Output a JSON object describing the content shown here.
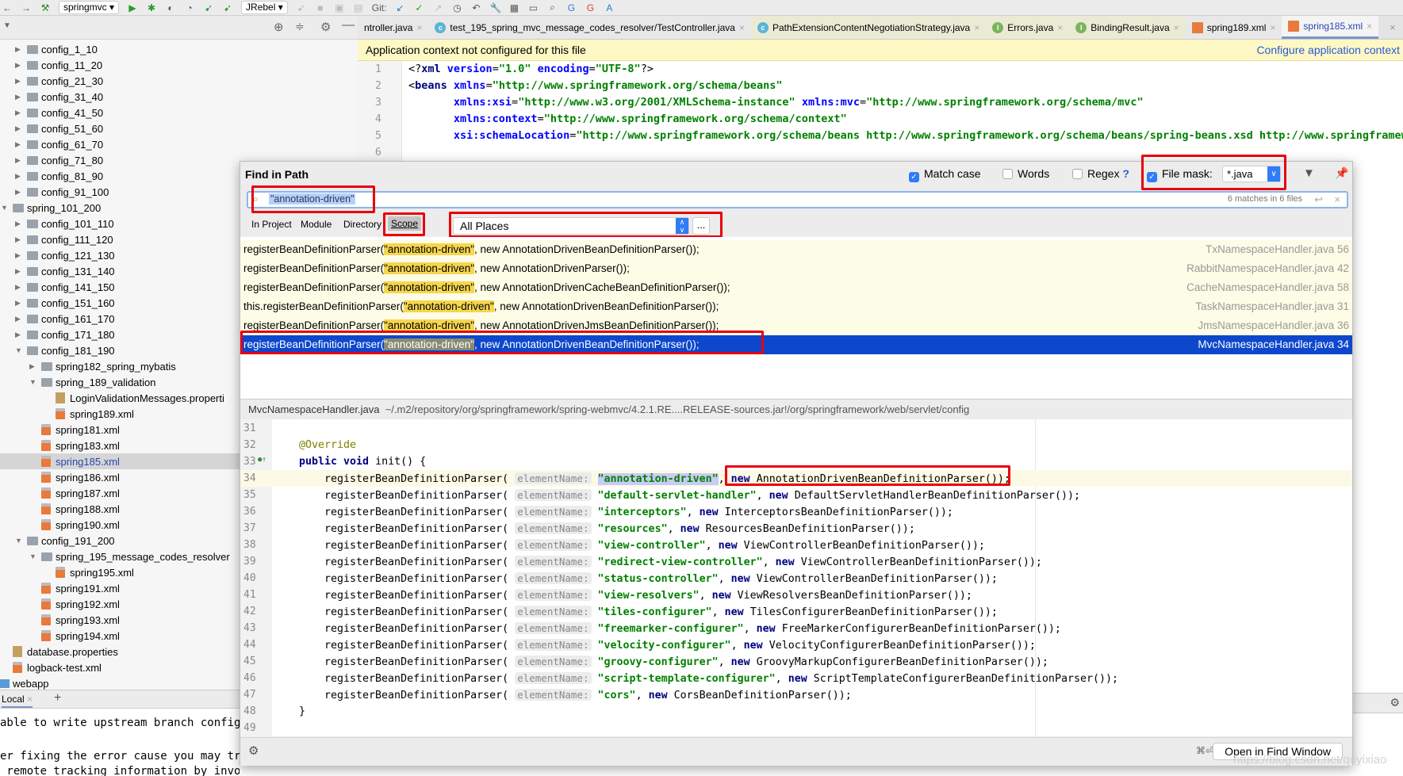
{
  "toolbar": {
    "run_config": "springmvc",
    "jrebel": "JRebel",
    "git_label": "Git:"
  },
  "tabs": [
    {
      "label": "ntroller.java",
      "kind": "plain",
      "style": "plain"
    },
    {
      "label": "test_195_spring_mvc_message_codes_resolver/TestController.java",
      "kind": "C",
      "style": "plain"
    },
    {
      "label": "PathExtensionContentNegotiationStrategy.java",
      "kind": "C",
      "style": "yel"
    },
    {
      "label": "Errors.java",
      "kind": "I",
      "style": "yel"
    },
    {
      "label": "BindingResult.java",
      "kind": "I",
      "style": "yel"
    },
    {
      "label": "spring189.xml",
      "kind": "xml",
      "style": "plain"
    },
    {
      "label": "spring185.xml",
      "kind": "xml",
      "style": "active"
    }
  ],
  "tree": [
    {
      "label": "config_1_10",
      "level": 2,
      "type": "folder",
      "arrow": "right"
    },
    {
      "label": "config_11_20",
      "level": 2,
      "type": "folder",
      "arrow": "right"
    },
    {
      "label": "config_21_30",
      "level": 2,
      "type": "folder",
      "arrow": "right"
    },
    {
      "label": "config_31_40",
      "level": 2,
      "type": "folder",
      "arrow": "right"
    },
    {
      "label": "config_41_50",
      "level": 2,
      "type": "folder",
      "arrow": "right"
    },
    {
      "label": "config_51_60",
      "level": 2,
      "type": "folder",
      "arrow": "right"
    },
    {
      "label": "config_61_70",
      "level": 2,
      "type": "folder",
      "arrow": "right"
    },
    {
      "label": "config_71_80",
      "level": 2,
      "type": "folder",
      "arrow": "right"
    },
    {
      "label": "config_81_90",
      "level": 2,
      "type": "folder",
      "arrow": "right"
    },
    {
      "label": "config_91_100",
      "level": 2,
      "type": "folder",
      "arrow": "right"
    },
    {
      "label": "spring_101_200",
      "level": 1,
      "type": "folder",
      "arrow": "down"
    },
    {
      "label": "config_101_110",
      "level": 2,
      "type": "folder",
      "arrow": "right"
    },
    {
      "label": "config_111_120",
      "level": 2,
      "type": "folder",
      "arrow": "right"
    },
    {
      "label": "config_121_130",
      "level": 2,
      "type": "folder",
      "arrow": "right"
    },
    {
      "label": "config_131_140",
      "level": 2,
      "type": "folder",
      "arrow": "right"
    },
    {
      "label": "config_141_150",
      "level": 2,
      "type": "folder",
      "arrow": "right"
    },
    {
      "label": "config_151_160",
      "level": 2,
      "type": "folder",
      "arrow": "right"
    },
    {
      "label": "config_161_170",
      "level": 2,
      "type": "folder",
      "arrow": "right"
    },
    {
      "label": "config_171_180",
      "level": 2,
      "type": "folder",
      "arrow": "right"
    },
    {
      "label": "config_181_190",
      "level": 2,
      "type": "folder",
      "arrow": "down"
    },
    {
      "label": "spring182_spring_mybatis",
      "level": 3,
      "type": "folder",
      "arrow": "right"
    },
    {
      "label": "spring_189_validation",
      "level": 3,
      "type": "folder",
      "arrow": "down"
    },
    {
      "label": "LoginValidationMessages.properti",
      "level": 4,
      "type": "props",
      "arrow": ""
    },
    {
      "label": "spring189.xml",
      "level": 4,
      "type": "xml",
      "arrow": ""
    },
    {
      "label": "spring181.xml",
      "level": 3,
      "type": "xml",
      "arrow": ""
    },
    {
      "label": "spring183.xml",
      "level": 3,
      "type": "xml",
      "arrow": ""
    },
    {
      "label": "spring185.xml",
      "level": 3,
      "type": "xml",
      "arrow": "",
      "selected": true
    },
    {
      "label": "spring186.xml",
      "level": 3,
      "type": "xml",
      "arrow": ""
    },
    {
      "label": "spring187.xml",
      "level": 3,
      "type": "xml",
      "arrow": ""
    },
    {
      "label": "spring188.xml",
      "level": 3,
      "type": "xml",
      "arrow": ""
    },
    {
      "label": "spring190.xml",
      "level": 3,
      "type": "xml",
      "arrow": ""
    },
    {
      "label": "config_191_200",
      "level": 2,
      "type": "folder",
      "arrow": "down"
    },
    {
      "label": "spring_195_message_codes_resolver",
      "level": 3,
      "type": "folder",
      "arrow": "down"
    },
    {
      "label": "spring195.xml",
      "level": 4,
      "type": "xml",
      "arrow": ""
    },
    {
      "label": "spring191.xml",
      "level": 3,
      "type": "xml",
      "arrow": ""
    },
    {
      "label": "spring192.xml",
      "level": 3,
      "type": "xml",
      "arrow": ""
    },
    {
      "label": "spring193.xml",
      "level": 3,
      "type": "xml",
      "arrow": ""
    },
    {
      "label": "spring194.xml",
      "level": 3,
      "type": "xml",
      "arrow": ""
    },
    {
      "label": "database.properties",
      "level": 1,
      "type": "props",
      "arrow": ""
    },
    {
      "label": "logback-test.xml",
      "level": 1,
      "type": "xml",
      "arrow": ""
    },
    {
      "label": "webapp",
      "level": 0,
      "type": "web",
      "arrow": ""
    }
  ],
  "terminal": {
    "tab": "Local",
    "lines": [
      "able to write upstream branch configur",
      "",
      "er fixing the error cause you may try",
      " remote tracking information by invoking"
    ]
  },
  "banner": {
    "message": "Application context not configured for this file",
    "link": "Configure application context"
  },
  "xml_lines": [
    {
      "n": "1",
      "tokens": [
        {
          "t": "<?",
          "k": "pl"
        },
        {
          "t": "xml ",
          "k": "tag"
        },
        {
          "t": "version",
          "k": "attr"
        },
        {
          "t": "=",
          "k": "pl"
        },
        {
          "t": "\"1.0\" ",
          "k": "str"
        },
        {
          "t": "encoding",
          "k": "attr"
        },
        {
          "t": "=",
          "k": "pl"
        },
        {
          "t": "\"UTF-8\"",
          "k": "str"
        },
        {
          "t": "?>",
          "k": "pl"
        }
      ]
    },
    {
      "n": "2",
      "tokens": [
        {
          "t": "<",
          "k": "pl"
        },
        {
          "t": "beans ",
          "k": "tag"
        },
        {
          "t": "xmlns",
          "k": "attr"
        },
        {
          "t": "=",
          "k": "pl"
        },
        {
          "t": "\"http://www.springframework.org/schema/beans\"",
          "k": "str"
        }
      ]
    },
    {
      "n": "3",
      "tokens": [
        {
          "t": "       xmlns:xsi",
          "k": "attr"
        },
        {
          "t": "=",
          "k": "pl"
        },
        {
          "t": "\"http://www.w3.org/2001/XMLSchema-instance\" ",
          "k": "str"
        },
        {
          "t": "xmlns:mvc",
          "k": "attr"
        },
        {
          "t": "=",
          "k": "pl"
        },
        {
          "t": "\"http://www.springframework.org/schema/mvc\"",
          "k": "str"
        }
      ]
    },
    {
      "n": "4",
      "tokens": [
        {
          "t": "       xmlns:context",
          "k": "attr"
        },
        {
          "t": "=",
          "k": "pl"
        },
        {
          "t": "\"http://www.springframework.org/schema/context\"",
          "k": "str"
        }
      ]
    },
    {
      "n": "5",
      "tokens": [
        {
          "t": "       xsi:schemaLocation",
          "k": "attr"
        },
        {
          "t": "=",
          "k": "pl"
        },
        {
          "t": "\"http://www.springframework.org/schema/beans http://www.springframework.org/schema/beans/spring-beans.xsd http://www.springframewor",
          "k": "str"
        }
      ]
    },
    {
      "n": "6",
      "tokens": []
    }
  ],
  "find": {
    "title": "Find in Path",
    "match_case": {
      "label": "Match case",
      "checked": true
    },
    "words": {
      "label": "Words",
      "checked": false
    },
    "regex": {
      "label": "Regex",
      "checked": false,
      "help": "?"
    },
    "file_mask": {
      "label": "File mask:",
      "checked": true,
      "value": "*.java"
    },
    "query": "\"annotation-driven\"",
    "match_count": "6 matches in 6 files",
    "scope_tabs": [
      "In Project",
      "Module",
      "Directory",
      "Scope"
    ],
    "scope_value": "All Places",
    "scope_more": "...",
    "results": [
      {
        "prefix": "registerBeanDefinitionParser(",
        "match": "\"annotation-driven\"",
        "suffix": ", new AnnotationDrivenBeanDefinitionParser());",
        "file": "TxNamespaceHandler.java 56"
      },
      {
        "prefix": "registerBeanDefinitionParser(",
        "match": "\"annotation-driven\"",
        "suffix": ", new AnnotationDrivenParser());",
        "file": "RabbitNamespaceHandler.java 42"
      },
      {
        "prefix": "registerBeanDefinitionParser(",
        "match": "\"annotation-driven\"",
        "suffix": ", new AnnotationDrivenCacheBeanDefinitionParser());",
        "file": "CacheNamespaceHandler.java 58"
      },
      {
        "prefix": "this.registerBeanDefinitionParser(",
        "match": "\"annotation-driven\"",
        "suffix": ", new AnnotationDrivenBeanDefinitionParser());",
        "file": "TaskNamespaceHandler.java 31"
      },
      {
        "prefix": "registerBeanDefinitionParser(",
        "match": "\"annotation-driven\"",
        "suffix": ", new AnnotationDrivenJmsBeanDefinitionParser());",
        "file": "JmsNamespaceHandler.java 36"
      },
      {
        "prefix": "registerBeanDefinitionParser(",
        "match": "\"annotation-driven\"",
        "suffix": ", new AnnotationDrivenBeanDefinitionParser());",
        "file": "MvcNamespaceHandler.java 34",
        "selected": true
      }
    ],
    "preview_file": "MvcNamespaceHandler.java",
    "preview_path": "~/.m2/repository/org/springframework/spring-webmvc/4.2.1.RE....RELEASE-sources.jar!/org/springframework/web/servlet/config",
    "hint_label": "elementName:",
    "method_call": "registerBeanDefinitionParser(",
    "annotation": "@Override",
    "method_decl": "init() {",
    "kw_public_void": "public void",
    "kw_new": "new",
    "closing": "}",
    "preview_start": 31,
    "registrations": [
      {
        "n": 34,
        "name": "\"annotation-driven\"",
        "parser": "AnnotationDrivenBeanDefinitionParser());"
      },
      {
        "n": 35,
        "name": "\"default-servlet-handler\"",
        "parser": "DefaultServletHandlerBeanDefinitionParser());"
      },
      {
        "n": 36,
        "name": "\"interceptors\"",
        "parser": "InterceptorsBeanDefinitionParser());"
      },
      {
        "n": 37,
        "name": "\"resources\"",
        "parser": "ResourcesBeanDefinitionParser());"
      },
      {
        "n": 38,
        "name": "\"view-controller\"",
        "parser": "ViewControllerBeanDefinitionParser());"
      },
      {
        "n": 39,
        "name": "\"redirect-view-controller\"",
        "parser": "ViewControllerBeanDefinitionParser());"
      },
      {
        "n": 40,
        "name": "\"status-controller\"",
        "parser": "ViewControllerBeanDefinitionParser());"
      },
      {
        "n": 41,
        "name": "\"view-resolvers\"",
        "parser": "ViewResolversBeanDefinitionParser());"
      },
      {
        "n": 42,
        "name": "\"tiles-configurer\"",
        "parser": "TilesConfigurerBeanDefinitionParser());"
      },
      {
        "n": 43,
        "name": "\"freemarker-configurer\"",
        "parser": "FreeMarkerConfigurerBeanDefinitionParser());"
      },
      {
        "n": 44,
        "name": "\"velocity-configurer\"",
        "parser": "VelocityConfigurerBeanDefinitionParser());"
      },
      {
        "n": 45,
        "name": "\"groovy-configurer\"",
        "parser": "GroovyMarkupConfigurerBeanDefinitionParser());"
      },
      {
        "n": 46,
        "name": "\"script-template-configurer\"",
        "parser": "ScriptTemplateConfigurerBeanDefinitionParser());"
      },
      {
        "n": 47,
        "name": "\"cors\"",
        "parser": "CorsBeanDefinitionParser());"
      }
    ],
    "shortcut": "⌘⏎",
    "open_button": "Open in Find Window"
  },
  "watermark": "https://blog.csdn.net/quyixiao",
  "colors": {
    "accent": "#2e7cf6",
    "selected_row": "#0d47cc",
    "match_highlight": "#f6d64f",
    "annotation_box": "#e8000b",
    "banner": "#fdf8c4"
  }
}
